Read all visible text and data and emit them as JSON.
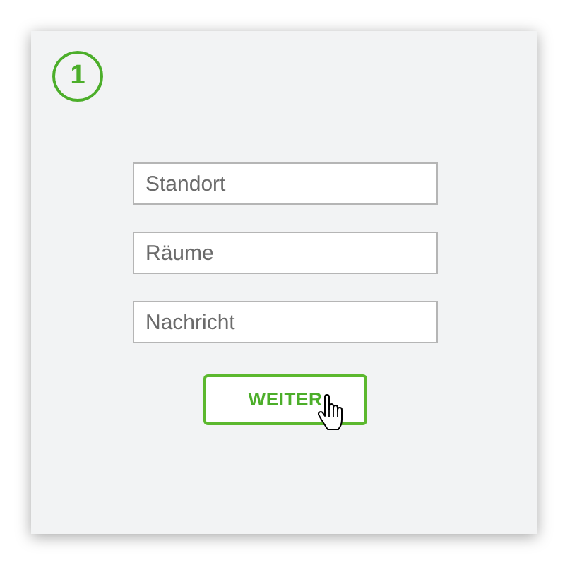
{
  "step": {
    "number": "1"
  },
  "fields": [
    {
      "placeholder": "Standort"
    },
    {
      "placeholder": "Räume"
    },
    {
      "placeholder": "Nachricht"
    }
  ],
  "button": {
    "label": "WEITER"
  }
}
